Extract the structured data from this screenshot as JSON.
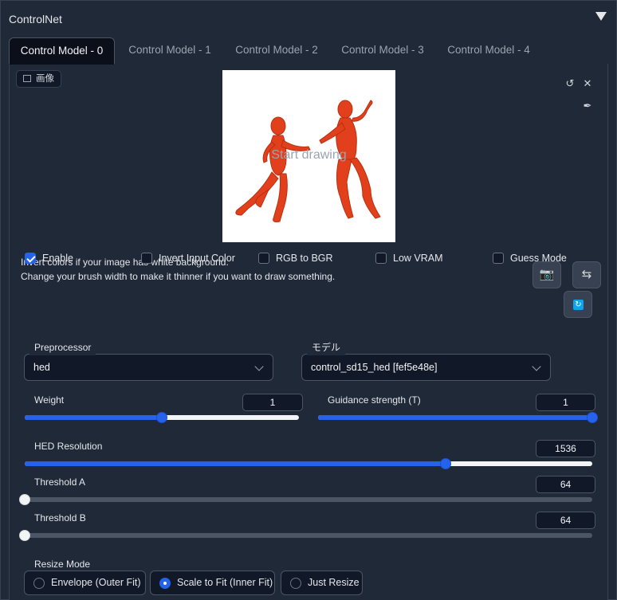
{
  "header": {
    "title": "ControlNet",
    "collapse_icon": "triangle-down-icon"
  },
  "tabs": [
    "Control Model - 0",
    "Control Model - 1",
    "Control Model - 2",
    "Control Model - 3",
    "Control Model - 4"
  ],
  "image_panel": {
    "label": "画像",
    "canvas_placeholder": "Start drawing",
    "hint_line1": "Invert colors if your image has white background.",
    "hint_line2": "Change your brush width to make it thinner if you want to draw something."
  },
  "options": {
    "enable": {
      "label": "Enable",
      "checked": true
    },
    "invert": {
      "label": "Invert Input Color",
      "checked": false
    },
    "rgb_bgr": {
      "label": "RGB to BGR",
      "checked": false
    },
    "low_vram": {
      "label": "Low VRAM",
      "checked": false
    },
    "guess": {
      "label": "Guess Mode",
      "checked": false
    }
  },
  "preprocessor": {
    "label": "Preprocessor",
    "value": "hed"
  },
  "model": {
    "label": "モデル",
    "value": "control_sd15_hed [fef5e48e]"
  },
  "weight": {
    "label": "Weight",
    "value": "1",
    "min": 0,
    "max": 2,
    "current": 1
  },
  "guidance": {
    "label": "Guidance strength (T)",
    "value": "1",
    "min": 0,
    "max": 1,
    "current": 1
  },
  "hed_resolution": {
    "label": "HED Resolution",
    "value": "1536",
    "min": 64,
    "max": 2048,
    "current": 1536
  },
  "threshold_a": {
    "label": "Threshold A",
    "value": "64",
    "fraction": 0
  },
  "threshold_b": {
    "label": "Threshold B",
    "value": "64",
    "fraction": 0
  },
  "resize_mode": {
    "label": "Resize Mode",
    "options": [
      "Envelope (Outer Fit)",
      "Scale to Fit (Inner Fit)",
      "Just Resize"
    ],
    "selected": "Scale to Fit (Inner Fit)"
  },
  "colors": {
    "accent": "#2563eb",
    "figure": "#e2401c"
  }
}
